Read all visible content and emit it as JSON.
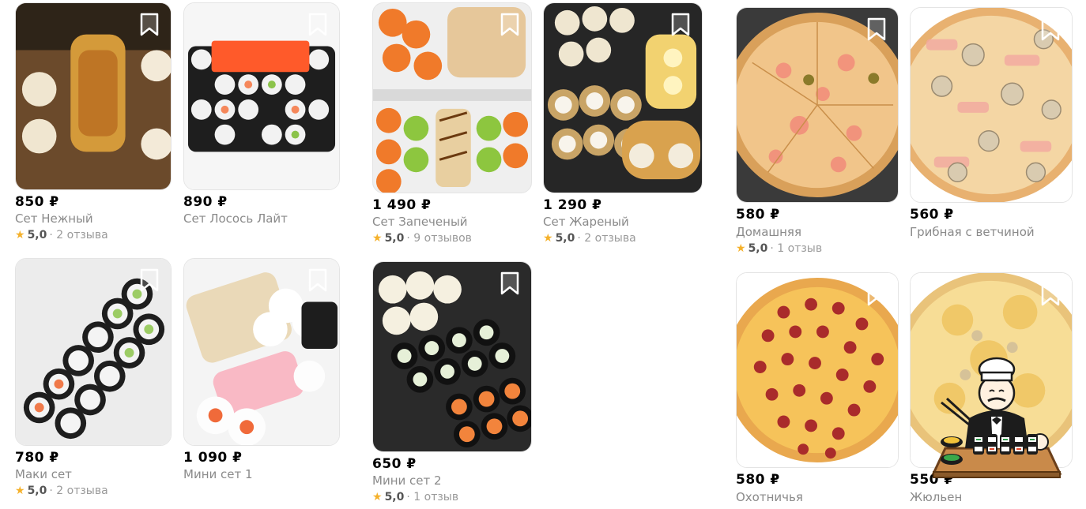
{
  "currency_symbol": "₽",
  "colors": {
    "star": "#f5b12b",
    "text_secondary": "#8a8a8a",
    "sushi_dark": "#222222",
    "pizza_crust": "#e0a050"
  },
  "products": [
    {
      "price": "850 ₽",
      "name": "Сет Нежный",
      "rating_score": "5,0",
      "rating_count": "· 2 отзыва"
    },
    {
      "price": "890 ₽",
      "name": "Сет Лосось Лайт"
    },
    {
      "price": "1 490 ₽",
      "name": "Сет Запеченый",
      "rating_score": "5,0",
      "rating_count": "· 9 отзывов"
    },
    {
      "price": "1 290 ₽",
      "name": "Сет Жареный",
      "rating_score": "5,0",
      "rating_count": "· 2 отзыва"
    },
    {
      "price": "580 ₽",
      "name": "Домашняя",
      "rating_score": "5,0",
      "rating_count": "· 1 отзыв"
    },
    {
      "price": "560 ₽",
      "name": "Грибная с ветчиной"
    },
    {
      "price": "780 ₽",
      "name": "Маки сет",
      "rating_score": "5,0",
      "rating_count": "· 2 отзыва"
    },
    {
      "price": "1 090 ₽",
      "name": "Мини сет 1"
    },
    {
      "price": "650 ₽",
      "name": "Мини сет 2",
      "rating_score": "5,0",
      "rating_count": "· 1 отзыв"
    },
    {
      "price": "580 ₽",
      "name": "Охотничья"
    },
    {
      "price": "550 ₽",
      "name": "Жюльен"
    }
  ],
  "icons": {
    "bookmark": "bookmark-icon",
    "star": "star-icon",
    "chef": "chef-sushi-icon"
  }
}
